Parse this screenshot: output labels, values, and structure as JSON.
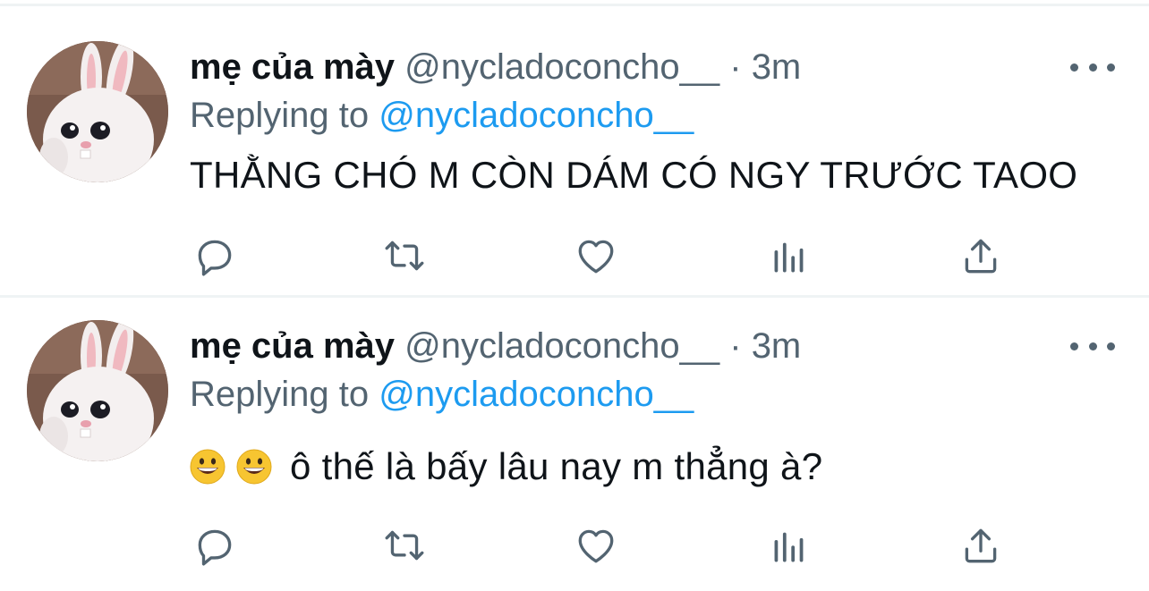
{
  "tweets": [
    {
      "display_name": "mẹ của mày",
      "handle": "@nycladoconcho__",
      "separator": "·",
      "time": "3m",
      "replying_prefix": "Replying to",
      "replying_handle": "@nycladoconcho__",
      "text": "THẰNG CHÓ M CÒN DÁM CÓ NGY TRƯỚC TAOO",
      "emojis": []
    },
    {
      "display_name": "mẹ của mày",
      "handle": "@nycladoconcho__",
      "separator": "·",
      "time": "3m",
      "replying_prefix": "Replying to",
      "replying_handle": "@nycladoconcho__",
      "text": "ô thế là bấy lâu nay m thẳng à?",
      "emojis": [
        "grinning-face",
        "grinning-face"
      ]
    }
  ],
  "icons": {
    "actions": [
      "reply-icon",
      "retweet-icon",
      "like-icon",
      "analytics-icon",
      "share-icon"
    ],
    "more": "more-options-icon"
  },
  "colors": {
    "text_primary": "#0f1419",
    "text_secondary": "#536471",
    "accent": "#1d9bf0",
    "divider": "#eff3f4"
  }
}
